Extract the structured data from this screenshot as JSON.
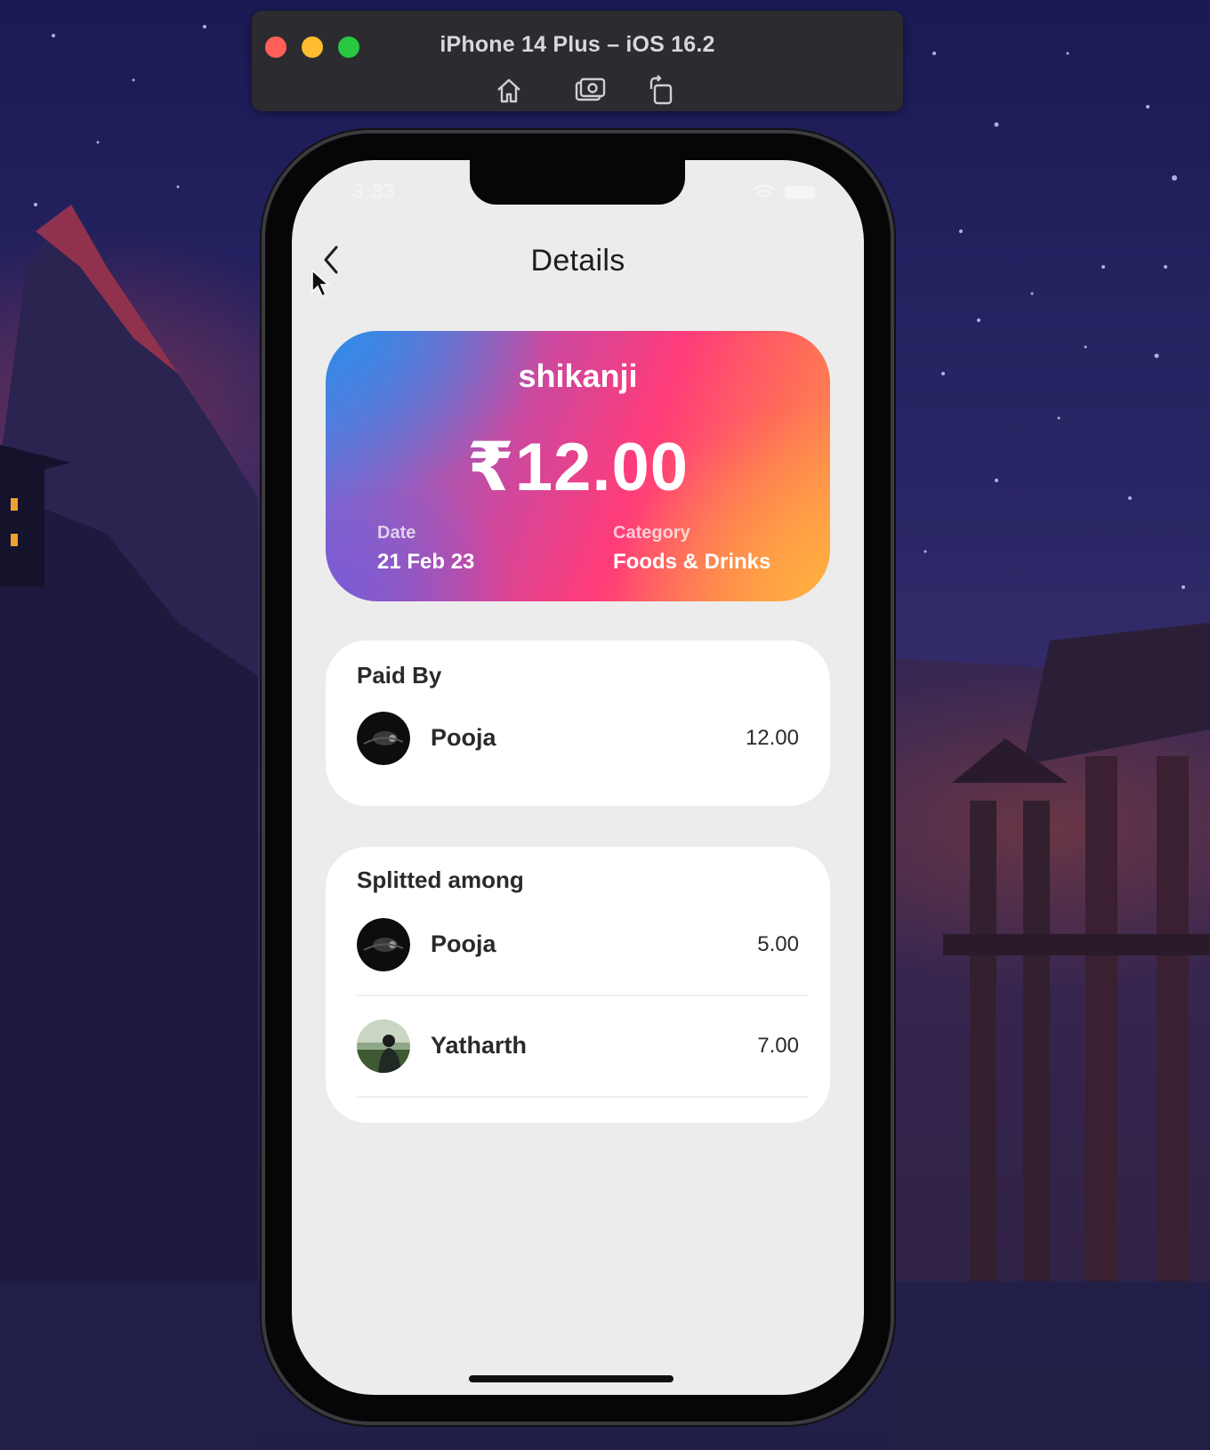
{
  "simulator": {
    "title": "iPhone 14 Plus – iOS 16.2",
    "buttons": [
      "home-icon",
      "screenshot-icon",
      "rotate-icon"
    ]
  },
  "status_bar": {
    "time": "3:33"
  },
  "nav": {
    "title": "Details",
    "back_icon": "chevron-left-icon"
  },
  "expense": {
    "name": "shikanji",
    "amount": "₹12.00",
    "date_label": "Date",
    "date_value": "21 Feb 23",
    "category_label": "Category",
    "category_value": "Foods & Drinks",
    "gradient_colors": [
      "#2f8ce8",
      "#ff3c7a",
      "#ff9a46"
    ]
  },
  "paid_by": {
    "title": "Paid By",
    "people": [
      {
        "name": "Pooja",
        "amount": "12.00"
      }
    ]
  },
  "splitted_among": {
    "title": "Splitted among",
    "people": [
      {
        "name": "Pooja",
        "amount": "5.00"
      },
      {
        "name": "Yatharth",
        "amount": "7.00"
      }
    ]
  }
}
